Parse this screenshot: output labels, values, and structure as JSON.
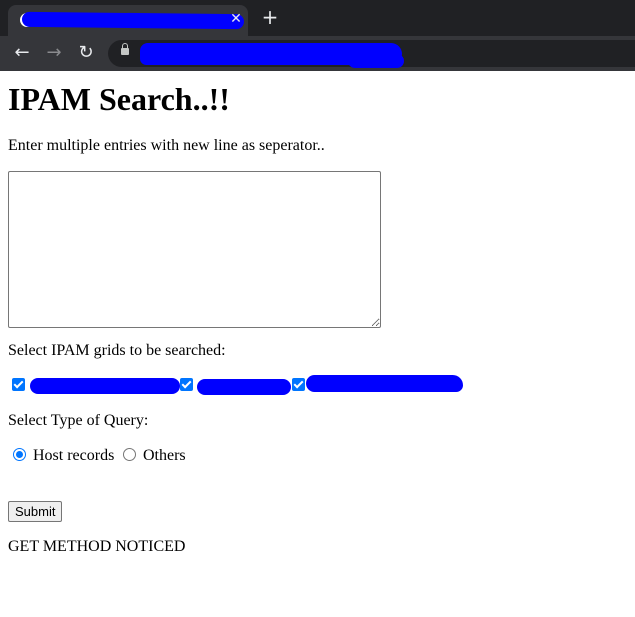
{
  "browser": {
    "tab_close_glyph": "✕",
    "new_tab_glyph": "+",
    "back_glyph": "←",
    "forward_glyph": "→",
    "reload_glyph": "↻"
  },
  "page": {
    "title": "IPAM Search..!!",
    "instructions": "Enter multiple entries with new line as seperator..",
    "entries_value": "",
    "grids_label": "Select IPAM grids to be searched:",
    "grids": [
      {
        "checked": true
      },
      {
        "checked": true
      },
      {
        "checked": true
      }
    ],
    "query_label": "Select Type of Query:",
    "query_options": [
      {
        "label": "Host records",
        "selected": true
      },
      {
        "label": "Others",
        "selected": false
      }
    ],
    "submit_label": "Submit",
    "status_text": "GET METHOD NOTICED"
  },
  "colors": {
    "redaction": "#0000ff",
    "accent": "#0075ff",
    "chrome_dark": "#202124",
    "chrome_toolbar": "#35363a"
  },
  "icons": [
    "favicon-icon",
    "close-icon",
    "plus-icon",
    "back-arrow-icon",
    "forward-arrow-icon",
    "reload-icon",
    "lock-icon"
  ]
}
